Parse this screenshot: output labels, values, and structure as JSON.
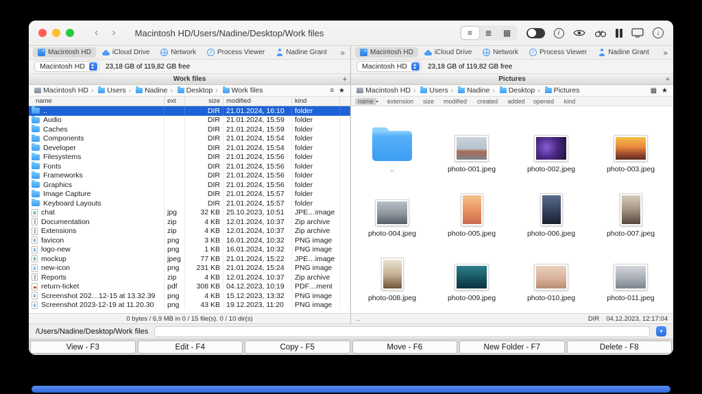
{
  "titlebar": {
    "title": "Macintosh HD/Users/Nadine/Desktop/Work files",
    "back_glyph": "‹",
    "forward_glyph": "›"
  },
  "toolbar": {
    "views": [
      {
        "icon": "list-view-icon",
        "glyph": "≡",
        "state": "active"
      },
      {
        "icon": "detail-view-icon",
        "glyph": "≣",
        "state": ""
      },
      {
        "icon": "grid-view-icon",
        "glyph": "▦",
        "state": ""
      }
    ],
    "info_glyph": "i",
    "download_glyph": "↓"
  },
  "left": {
    "favorites": [
      {
        "label": "Macintosh HD",
        "icon": "drive",
        "state": "active"
      },
      {
        "label": "iCloud Drive",
        "icon": "cloud",
        "state": ""
      },
      {
        "label": "Network",
        "icon": "network",
        "state": ""
      },
      {
        "label": "Process Viewer",
        "icon": "gauge",
        "state": ""
      },
      {
        "label": "Nadine Grant",
        "icon": "user",
        "state": ""
      }
    ],
    "favorites_more": "»",
    "drive": {
      "name": "Macintosh HD",
      "free": "23,18 GB of 119,82 GB free"
    },
    "tab": {
      "title": "Work files",
      "add": "+"
    },
    "breadcrumb": [
      {
        "label": "Macintosh HD",
        "icon": "drive"
      },
      {
        "label": "Users",
        "icon": "folder"
      },
      {
        "label": "Nadine",
        "icon": "folder"
      },
      {
        "label": "Desktop",
        "icon": "folder"
      },
      {
        "label": "Work files",
        "icon": "folder"
      }
    ],
    "view_glyph": "≡",
    "star_glyph": "★",
    "columns": [
      {
        "label": "name"
      },
      {
        "label": "ext"
      },
      {
        "label": "size"
      },
      {
        "label": "modified"
      },
      {
        "label": "kind"
      }
    ],
    "rows": [
      {
        "name": "..",
        "ext": "",
        "size": "DIR",
        "modified": "21.01.2024, 16:10",
        "kind": "folder",
        "icon": "folder",
        "state": "selected"
      },
      {
        "name": "Audio",
        "ext": "",
        "size": "DIR",
        "modified": "21.01.2024, 15:59",
        "kind": "folder",
        "icon": "folder",
        "state": ""
      },
      {
        "name": "Caches",
        "ext": "",
        "size": "DIR",
        "modified": "21.01.2024, 15:59",
        "kind": "folder",
        "icon": "folder",
        "state": ""
      },
      {
        "name": "Components",
        "ext": "",
        "size": "DIR",
        "modified": "21.01.2024, 15:54",
        "kind": "folder",
        "icon": "folder",
        "state": ""
      },
      {
        "name": "Developer",
        "ext": "",
        "size": "DIR",
        "modified": "21.01.2024, 15:54",
        "kind": "folder",
        "icon": "folder",
        "state": ""
      },
      {
        "name": "Filesystems",
        "ext": "",
        "size": "DIR",
        "modified": "21.01.2024, 15:56",
        "kind": "folder",
        "icon": "folder",
        "state": ""
      },
      {
        "name": "Fonts",
        "ext": "",
        "size": "DIR",
        "modified": "21.01.2024, 15:56",
        "kind": "folder",
        "icon": "folder",
        "state": ""
      },
      {
        "name": "Frameworks",
        "ext": "",
        "size": "DIR",
        "modified": "21.01.2024, 15:56",
        "kind": "folder",
        "icon": "folder",
        "state": ""
      },
      {
        "name": "Graphics",
        "ext": "",
        "size": "DIR",
        "modified": "21.01.2024, 15:56",
        "kind": "folder",
        "icon": "folder",
        "state": ""
      },
      {
        "name": "Image Capture",
        "ext": "",
        "size": "DIR",
        "modified": "21.01.2024, 15:57",
        "kind": "folder",
        "icon": "folder",
        "state": ""
      },
      {
        "name": "Keyboard Layouts",
        "ext": "",
        "size": "DIR",
        "modified": "21.01.2024, 15:57",
        "kind": "folder",
        "icon": "folder",
        "state": ""
      },
      {
        "name": "chat",
        "ext": "jpg",
        "size": "32 KB",
        "modified": "25.10.2023, 10:51",
        "kind": "JPE…image",
        "icon": "image",
        "state": ""
      },
      {
        "name": "Documentation",
        "ext": "zip",
        "size": "4 KB",
        "modified": "12.01.2024, 10:37",
        "kind": "Zip archive",
        "icon": "zip",
        "state": ""
      },
      {
        "name": "Extensions",
        "ext": "zip",
        "size": "4 KB",
        "modified": "12.01.2024, 10:37",
        "kind": "Zip archive",
        "icon": "zip",
        "state": ""
      },
      {
        "name": "favicon",
        "ext": "png",
        "size": "3 KB",
        "modified": "16.01.2024, 10:32",
        "kind": "PNG image",
        "icon": "png",
        "state": ""
      },
      {
        "name": "logo-new",
        "ext": "png",
        "size": "1 KB",
        "modified": "16.01.2024, 10:32",
        "kind": "PNG image",
        "icon": "png",
        "state": ""
      },
      {
        "name": "mockup",
        "ext": "jpeg",
        "size": "77 KB",
        "modified": "21.01.2024, 15:22",
        "kind": "JPE…image",
        "icon": "image",
        "state": ""
      },
      {
        "name": "new-icon",
        "ext": "png",
        "size": "231 KB",
        "modified": "21.01.2024, 15:24",
        "kind": "PNG image",
        "icon": "png",
        "state": ""
      },
      {
        "name": "Reports",
        "ext": "zip",
        "size": "4 KB",
        "modified": "12.01.2024, 10:37",
        "kind": "Zip archive",
        "icon": "zip",
        "state": ""
      },
      {
        "name": "return-ticket",
        "ext": "pdf",
        "size": "308 KB",
        "modified": "04.12.2023, 10:19",
        "kind": "PDF…ment",
        "icon": "pdf",
        "state": ""
      },
      {
        "name": "Screenshot 202…12-15 at 13.32.39",
        "ext": "png",
        "size": "4 KB",
        "modified": "15.12.2023, 13:32",
        "kind": "PNG image",
        "icon": "png",
        "state": ""
      },
      {
        "name": "Screenshot 2023-12-19 at 11.20.30",
        "ext": "png",
        "size": "43 KB",
        "modified": "19.12.2023, 11:20",
        "kind": "PNG image",
        "icon": "png",
        "state": ""
      }
    ],
    "status": "0 bytes / 6,9 MB in 0 / 15 file(s). 0 / 10 dir(s)"
  },
  "right": {
    "favorites": [
      {
        "label": "Macintosh HD",
        "icon": "drive",
        "state": "active"
      },
      {
        "label": "iCloud Drive",
        "icon": "cloud",
        "state": ""
      },
      {
        "label": "Network",
        "icon": "network",
        "state": ""
      },
      {
        "label": "Process Viewer",
        "icon": "gauge",
        "state": ""
      },
      {
        "label": "Nadine Grant",
        "icon": "user",
        "state": ""
      }
    ],
    "favorites_more": "»",
    "drive": {
      "name": "Macintosh HD",
      "free": "23,18 GB of 119,82 GB free"
    },
    "tab": {
      "title": "Pictures",
      "add": "+"
    },
    "breadcrumb": [
      {
        "label": "Macintosh HD",
        "icon": "drive"
      },
      {
        "label": "Users",
        "icon": "folder"
      },
      {
        "label": "Nadine",
        "icon": "folder"
      },
      {
        "label": "Desktop",
        "icon": "folder"
      },
      {
        "label": "Pictures",
        "icon": "folder"
      }
    ],
    "view_glyph": "▦",
    "star_glyph": "★",
    "columns": [
      {
        "label": "name",
        "sorted": "sorted",
        "arrow": "▴"
      },
      {
        "label": "extension"
      },
      {
        "label": "size"
      },
      {
        "label": "modified"
      },
      {
        "label": "created"
      },
      {
        "label": "added"
      },
      {
        "label": "opened"
      },
      {
        "label": "kind"
      }
    ],
    "items": [
      {
        "name": "..",
        "kind": "folder",
        "orient": "",
        "grad": ""
      },
      {
        "name": "photo-001.jpeg",
        "kind": "image",
        "orient": "land",
        "grad": "linear-gradient(180deg,#c9d3dc 0%,#b6c2cd 52%,#a86a52 64%,#7d848c 100%)"
      },
      {
        "name": "photo-002.jpeg",
        "kind": "image",
        "orient": "land",
        "grad": "radial-gradient(circle at 35% 45%,#8a5fd6 0%,#4a2a86 45%,#1d1233 100%)"
      },
      {
        "name": "photo-003.jpeg",
        "kind": "image",
        "orient": "land",
        "grad": "linear-gradient(180deg,#f5c04a 0%,#e8863c 45%,#9c4b2e 75%,#5c2d20 100%)"
      },
      {
        "name": "photo-004.jpeg",
        "kind": "image",
        "orient": "land",
        "grad": "linear-gradient(180deg,#b9bfc6 0%,#8e959d 55%,#565d66 100%)"
      },
      {
        "name": "photo-005.jpeg",
        "kind": "image",
        "orient": "port",
        "grad": "linear-gradient(180deg,#f4c08a 0%,#e89060 55%,#c66a4e 100%)"
      },
      {
        "name": "photo-006.jpeg",
        "kind": "image",
        "orient": "port",
        "grad": "linear-gradient(180deg,#5a6d8c 0%,#33415c 55%,#16202f 100%)"
      },
      {
        "name": "photo-007.jpeg",
        "kind": "image",
        "orient": "port",
        "grad": "linear-gradient(180deg,#d8caba 0%,#a99a88 45%,#55483c 100%)"
      },
      {
        "name": "photo-008.jpeg",
        "kind": "image",
        "orient": "port",
        "grad": "linear-gradient(180deg,#ece4d2 0%,#c5b295 50%,#6f5639 100%)"
      },
      {
        "name": "photo-009.jpeg",
        "kind": "image",
        "orient": "land",
        "grad": "linear-gradient(180deg,#2e7f8a 0%,#14505c 60%,#0a323c 100%)"
      },
      {
        "name": "photo-010.jpeg",
        "kind": "image",
        "orient": "land",
        "grad": "linear-gradient(180deg,#ead0bd 0%,#d9b29a 55%,#b98c72 100%)"
      },
      {
        "name": "photo-011.jpeg",
        "kind": "image",
        "orient": "land",
        "grad": "linear-gradient(180deg,#d3d7dc 0%,#a9aeb6 55%,#7c828c 100%)"
      }
    ],
    "status": {
      "name": "..",
      "size": "DIR",
      "date": "04.12.2023, 12:17:04"
    }
  },
  "command_line": {
    "prompt": "/Users/Nadine/Desktop/Work files",
    "history_glyph": "▾"
  },
  "fkeys": [
    {
      "label": "View - F3"
    },
    {
      "label": "Edit - F4"
    },
    {
      "label": "Copy - F5"
    },
    {
      "label": "Move - F6"
    },
    {
      "label": "New Folder - F7"
    },
    {
      "label": "Delete - F8"
    }
  ]
}
